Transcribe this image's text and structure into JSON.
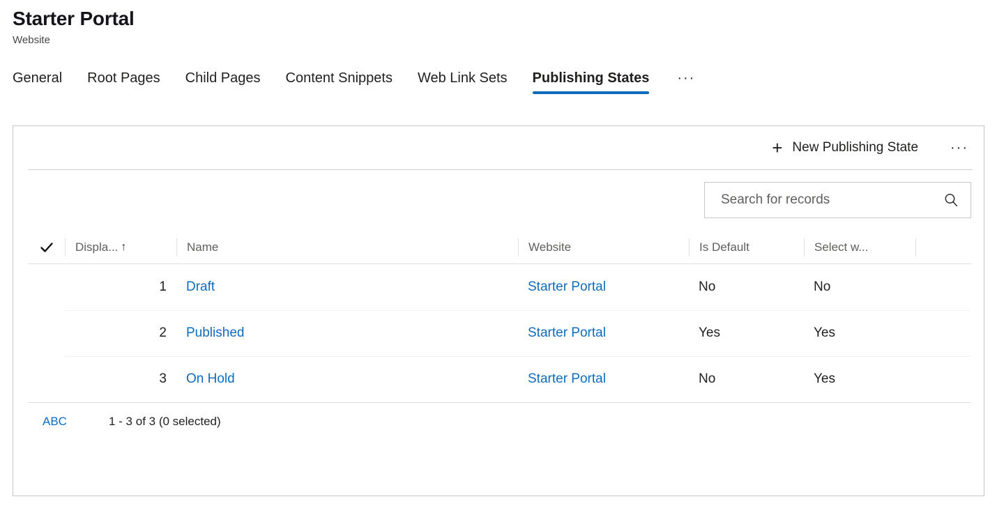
{
  "header": {
    "title": "Starter Portal",
    "subtitle": "Website"
  },
  "tabs": [
    {
      "label": "General",
      "active": false
    },
    {
      "label": "Root Pages",
      "active": false
    },
    {
      "label": "Child Pages",
      "active": false
    },
    {
      "label": "Content Snippets",
      "active": false
    },
    {
      "label": "Web Link Sets",
      "active": false
    },
    {
      "label": "Publishing States",
      "active": true
    }
  ],
  "tab_overflow_label": "···",
  "command_bar": {
    "new_label": "New Publishing State",
    "plus_icon": "add-icon",
    "overflow_label": "···"
  },
  "search": {
    "placeholder": "Search for records",
    "value": "",
    "icon": "search-icon"
  },
  "grid": {
    "select_all_icon": "checkmark-icon",
    "columns": [
      {
        "label": "Displa...",
        "sorted": true,
        "sort_arrow": "↑"
      },
      {
        "label": "Name",
        "sorted": false,
        "sort_arrow": ""
      },
      {
        "label": "Website",
        "sorted": false,
        "sort_arrow": ""
      },
      {
        "label": "Is Default",
        "sorted": false,
        "sort_arrow": ""
      },
      {
        "label": "Select w...",
        "sorted": false,
        "sort_arrow": ""
      }
    ],
    "rows": [
      {
        "display_order": "1",
        "name": "Draft",
        "website": "Starter Portal",
        "is_default": "No",
        "select_w": "No"
      },
      {
        "display_order": "2",
        "name": "Published",
        "website": "Starter Portal",
        "is_default": "Yes",
        "select_w": "Yes"
      },
      {
        "display_order": "3",
        "name": "On Hold",
        "website": "Starter Portal",
        "is_default": "No",
        "select_w": "Yes"
      }
    ],
    "footer": {
      "jump_bar_label": "ABC",
      "record_count": "1 - 3 of 3 (0 selected)"
    }
  },
  "colors": {
    "link": "#0f6cbd",
    "accent_underline": "#0f6cbd",
    "panel_border": "#c8c6c4",
    "grid_line": "#e1dfdd",
    "row_line": "#f3f2f1",
    "muted_text": "#605e5c",
    "text": "#201f1e"
  }
}
